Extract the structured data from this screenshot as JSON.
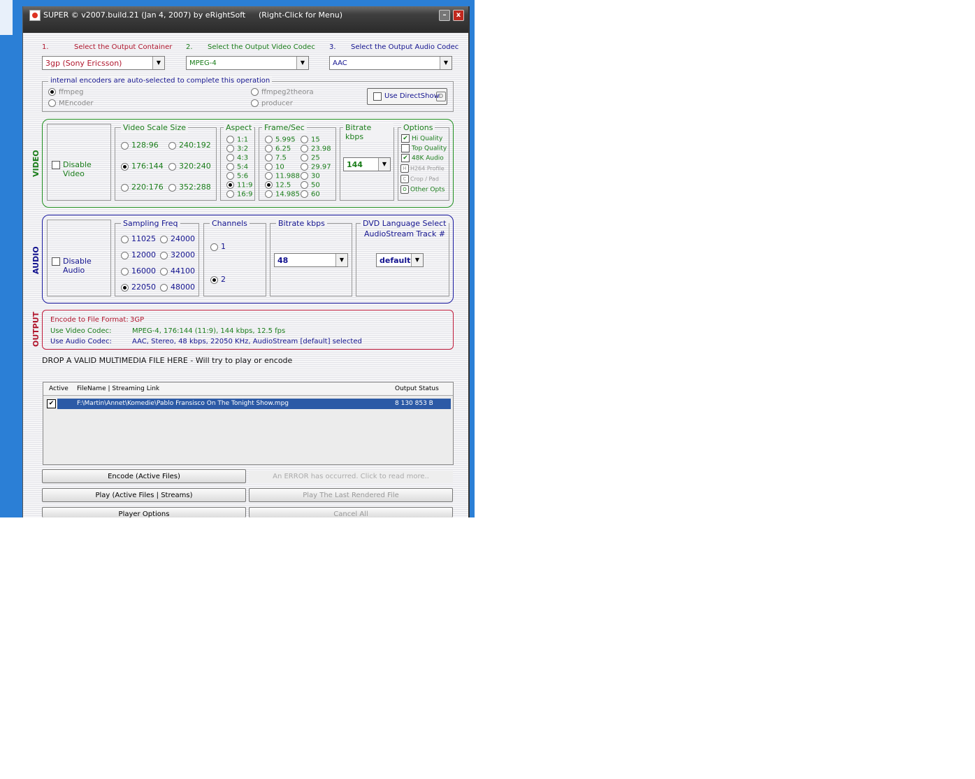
{
  "window": {
    "title": "SUPER © v2007.build.21 (Jan 4, 2007) by eRightSoft",
    "hint": "(Right-Click for Menu)",
    "min_glyph": "–",
    "close_glyph": "x"
  },
  "steps": {
    "s1_num": "1.",
    "s1_label": "Select the Output Container",
    "s2_num": "2.",
    "s2_label": "Select the Output Video Codec",
    "s3_num": "3.",
    "s3_label": "Select the Output Audio Codec",
    "container_value": "3gp  (Sony Ericsson)",
    "video_codec_value": "MPEG-4",
    "audio_codec_value": "AAC"
  },
  "encoders": {
    "title": "internal encoders are auto-selected to complete this operation",
    "ffmpeg": "ffmpeg",
    "mencoder": "MEncoder",
    "ffmpeg2theora": "ffmpeg2theora",
    "producer": "producer",
    "directshow": "Use DirectShow",
    "directshow_key": "D"
  },
  "video": {
    "section_label": "VIDEO",
    "disable": "Disable Video",
    "scale_title": "Video Scale Size",
    "scales": [
      "128:96",
      "240:192",
      "176:144",
      "320:240",
      "220:176",
      "352:288"
    ],
    "aspect_title": "Aspect",
    "aspects": [
      "1:1",
      "3:2",
      "4:3",
      "5:4",
      "5:6",
      "11:9",
      "16:9"
    ],
    "fps_title": "Frame/Sec",
    "fps_left": [
      "5.995",
      "6.25",
      "7.5",
      "10",
      "11.988",
      "12.5",
      "14.985"
    ],
    "fps_right": [
      "15",
      "23.98",
      "25",
      "29.97",
      "30",
      "50",
      "60"
    ],
    "bitrate_title": "Bitrate  kbps",
    "bitrate_value": "144",
    "options_title": "Options",
    "hiq": "Hi Quality",
    "topq": "Top Quality",
    "audio48k": "48K Audio",
    "h264": "H264 Profile",
    "h264_key": "H",
    "crop": "Crop / Pad",
    "crop_key": "C",
    "other": "Other Opts",
    "other_key": "O"
  },
  "audio": {
    "section_label": "AUDIO",
    "disable": "Disable Audio",
    "freq_title": "Sampling Freq",
    "freq_left": [
      "11025",
      "12000",
      "16000",
      "22050"
    ],
    "freq_right": [
      "24000",
      "32000",
      "44100",
      "48000"
    ],
    "channels_title": "Channels",
    "ch1": "1",
    "ch2": "2",
    "bitrate_title": "Bitrate  kbps",
    "bitrate_value": "48",
    "dvd_title": "DVD Language Select",
    "dvd_sub": "AudioStream  Track #",
    "dvd_value": "default"
  },
  "output": {
    "section_label": "OUTPUT",
    "fmt_label": "Encode to File Format:",
    "fmt_value": "3GP",
    "vc_label": "Use Video Codec:",
    "vc_value": "MPEG-4,  176:144 (11:9),  144 kbps,  12.5 fps",
    "ac_label": "Use Audio Codec:",
    "ac_value": "AAC,  Stereo,  48 kbps,  22050 KHz,  AudioStream [default] selected"
  },
  "drop_text": "DROP A VALID MULTIMEDIA FILE HERE - Will try to play or encode",
  "list": {
    "col_active": "Active",
    "col_file": "FileName  |  Streaming Link",
    "col_status": "Output Status",
    "rows": [
      {
        "file": "F:\\Martin\\Annet\\Komedie\\Pablo Fransisco On The Tonight Show.mpg",
        "status": "8 130 853 B"
      }
    ]
  },
  "buttons": {
    "encode": "Encode (Active Files)",
    "error": "An ERROR has occurred. Click to read more..",
    "play": "Play (Active Files | Streams)",
    "play_last": "Play The Last Rendered File",
    "player_options": "Player Options",
    "cancel_all": "Cancel All"
  },
  "colors": {
    "step1": "#b0162d",
    "step2": "#1a7d1a",
    "step3": "#13138f",
    "video_border": "#1f8f1f",
    "audio_border": "#1a1aa0",
    "output_border": "#c01a3a",
    "selected_row": "#2c5aa6"
  }
}
